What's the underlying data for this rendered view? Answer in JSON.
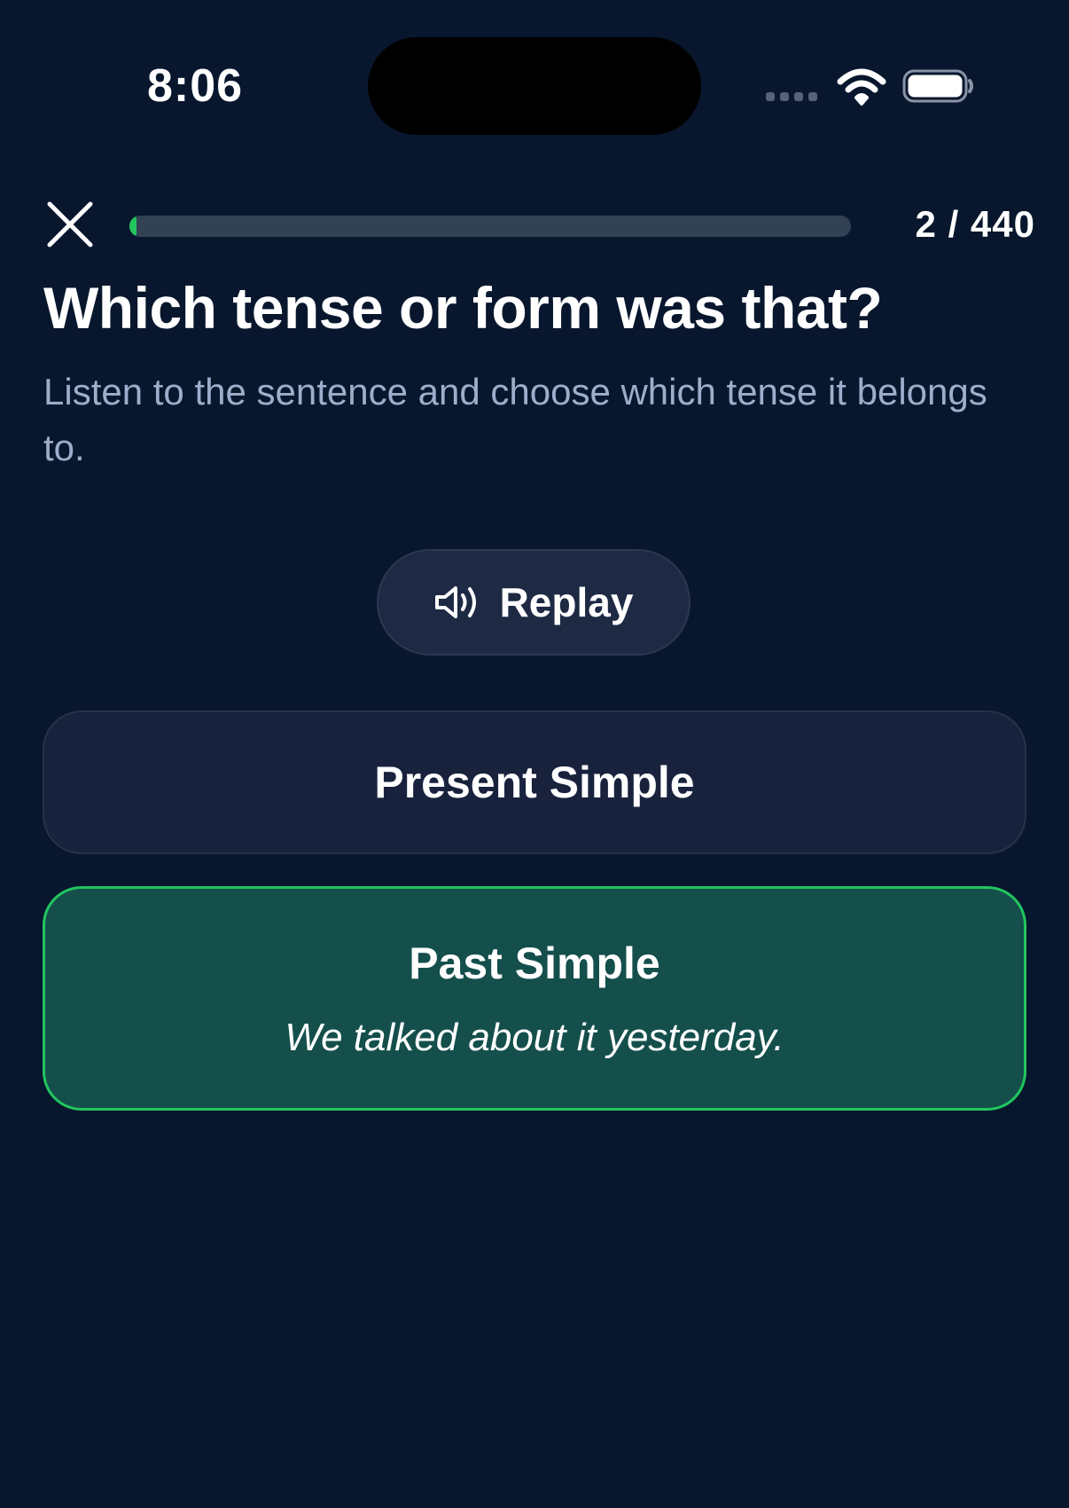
{
  "status_bar": {
    "time": "8:06",
    "icons": [
      "signal-icon",
      "wifi-icon",
      "battery-icon"
    ]
  },
  "progress": {
    "close_icon": "close-icon",
    "current": 2,
    "total": 440,
    "label": "2 / 440",
    "fill_fraction": 0.005
  },
  "question": {
    "title": "Which tense or form was that?",
    "subtitle": "Listen to the sentence and choose which tense it belongs to."
  },
  "replay": {
    "label": "Replay",
    "icon": "speaker-icon"
  },
  "options": [
    {
      "label": "Present Simple",
      "state": "default"
    },
    {
      "label": "Past Simple",
      "example": "We talked about it yesterday.",
      "state": "correct"
    }
  ],
  "colors": {
    "background": "#08172d",
    "accent": "#22c55e",
    "correct_fill": "#144f4c",
    "option_fill": "#18223d",
    "subtitle_text": "#9fadcb"
  }
}
